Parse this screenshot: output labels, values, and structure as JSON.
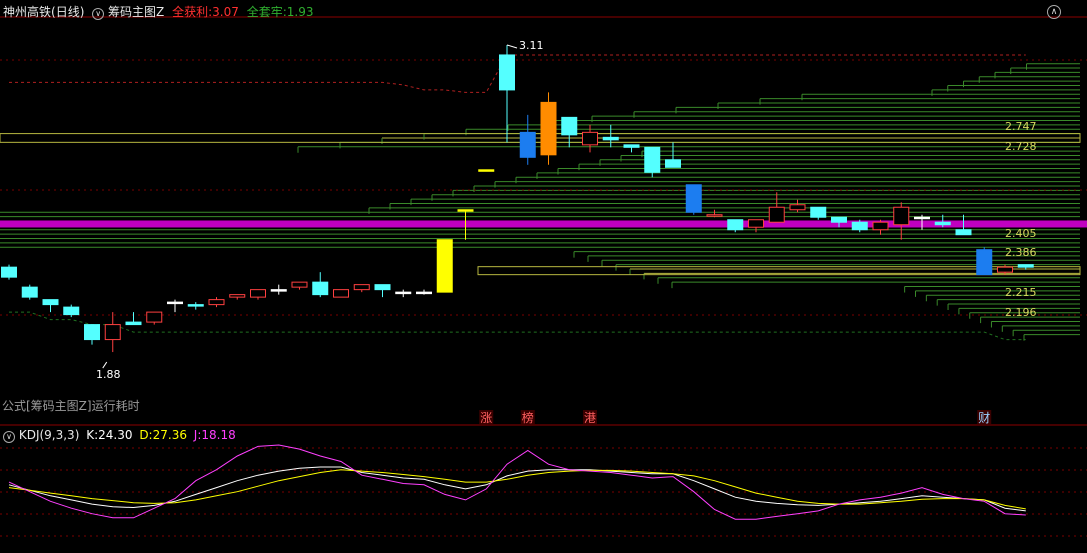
{
  "header": {
    "stock": "神州高铁",
    "period": "(日线)",
    "indicator": "筹码主图Z",
    "profit_label": "全获利:",
    "profit_value": "3.07",
    "trapped_label": "全套牢:",
    "trapped_value": "1.93"
  },
  "lower_header": {
    "name": "KDJ(9,3,3)",
    "k_label": "K:",
    "k_value": "24.30",
    "d_label": "D:",
    "d_value": "27.36",
    "j_label": "J:",
    "j_value": "18.18"
  },
  "notice": "公式[筹码主图Z]运行耗时",
  "colors": {
    "up": "#ff4040",
    "down": "#54ffff",
    "strong_down": "#1c7df0",
    "limit_up": "#ffff00",
    "orange": "#ff8c00",
    "cost_line": "#c000c0",
    "chip": "#3a8a2a",
    "chip_hl": "#b8b840",
    "profit_line": "#b02020",
    "trapped_line": "#207020",
    "k": "#ffffff",
    "d": "#ffff00",
    "j": "#ff40ff"
  },
  "chart_data": [
    {
      "type": "candlestick",
      "title": "神州高铁 (日线)",
      "ylim": [
        1.72,
        3.21
      ],
      "price_labels": [
        "2.747",
        "2.728",
        "2.405",
        "2.386",
        "2.215",
        "2.196"
      ],
      "high_mark": "3.11",
      "low_mark": "1.88",
      "main_cost": 2.395,
      "profit_line": [
        2.96,
        2.96,
        2.96,
        2.96,
        2.96,
        2.96,
        2.96,
        2.96,
        2.96,
        2.96,
        2.96,
        2.96,
        2.96,
        2.96,
        2.96,
        2.96,
        2.96,
        2.96,
        2.96,
        2.95,
        2.93,
        2.93,
        2.92,
        2.92,
        3.07,
        3.07,
        3.07,
        3.07,
        3.07,
        3.07,
        3.07,
        3.07,
        3.07,
        3.07,
        3.07,
        3.07,
        3.07,
        3.07,
        3.07,
        3.07,
        3.07,
        3.07,
        3.07,
        3.07,
        3.07,
        3.07,
        3.07,
        3.07,
        3.07,
        3.07
      ],
      "trapped_line": [
        2.04,
        2.04,
        2.01,
        2.01,
        1.99,
        1.99,
        1.96,
        1.96,
        1.96,
        1.96,
        1.96,
        1.96,
        1.96,
        1.96,
        1.96,
        1.96,
        1.96,
        1.96,
        1.96,
        1.96,
        1.96,
        1.96,
        1.96,
        1.96,
        1.96,
        1.96,
        1.96,
        1.96,
        1.96,
        1.96,
        1.96,
        1.96,
        1.96,
        1.96,
        1.96,
        1.96,
        1.96,
        1.96,
        1.96,
        1.96,
        1.96,
        1.96,
        1.96,
        1.96,
        1.96,
        1.96,
        1.96,
        1.96,
        1.93,
        1.93
      ],
      "candles": [
        {
          "o": 2.22,
          "h": 2.23,
          "l": 2.17,
          "c": 2.18,
          "color": "down"
        },
        {
          "o": 2.14,
          "h": 2.15,
          "l": 2.09,
          "c": 2.1,
          "color": "down"
        },
        {
          "o": 2.09,
          "h": 2.09,
          "l": 2.04,
          "c": 2.07,
          "color": "down"
        },
        {
          "o": 2.06,
          "h": 2.07,
          "l": 2.02,
          "c": 2.03,
          "color": "down"
        },
        {
          "o": 1.99,
          "h": 1.99,
          "l": 1.91,
          "c": 1.93,
          "color": "down"
        },
        {
          "o": 1.93,
          "h": 2.04,
          "l": 1.88,
          "c": 1.99,
          "color": "up"
        },
        {
          "o": 2.0,
          "h": 2.04,
          "l": 1.99,
          "c": 1.99,
          "color": "down"
        },
        {
          "o": 2.0,
          "h": 2.04,
          "l": 1.99,
          "c": 2.04,
          "color": "up"
        },
        {
          "o": 2.08,
          "h": 2.09,
          "l": 2.04,
          "c": 2.08,
          "color": "white"
        },
        {
          "o": 2.07,
          "h": 2.08,
          "l": 2.05,
          "c": 2.07,
          "color": "down"
        },
        {
          "o": 2.07,
          "h": 2.1,
          "l": 2.06,
          "c": 2.09,
          "color": "up"
        },
        {
          "o": 2.1,
          "h": 2.11,
          "l": 2.09,
          "c": 2.11,
          "color": "up"
        },
        {
          "o": 2.1,
          "h": 2.12,
          "l": 2.09,
          "c": 2.13,
          "color": "up"
        },
        {
          "o": 2.13,
          "h": 2.15,
          "l": 2.11,
          "c": 2.13,
          "color": "white"
        },
        {
          "o": 2.14,
          "h": 2.15,
          "l": 2.13,
          "c": 2.16,
          "color": "up"
        },
        {
          "o": 2.16,
          "h": 2.2,
          "l": 2.1,
          "c": 2.11,
          "color": "down"
        },
        {
          "o": 2.1,
          "h": 2.13,
          "l": 2.1,
          "c": 2.13,
          "color": "up"
        },
        {
          "o": 2.13,
          "h": 2.15,
          "l": 2.12,
          "c": 2.15,
          "color": "up"
        },
        {
          "o": 2.15,
          "h": 2.15,
          "l": 2.1,
          "c": 2.13,
          "color": "down"
        },
        {
          "o": 2.12,
          "h": 2.13,
          "l": 2.1,
          "c": 2.12,
          "color": "white"
        },
        {
          "o": 2.12,
          "h": 2.13,
          "l": 2.11,
          "c": 2.12,
          "color": "white"
        },
        {
          "o": 2.12,
          "h": 2.33,
          "l": 2.12,
          "c": 2.33,
          "color": "limit_up"
        },
        {
          "o": 2.45,
          "h": 2.45,
          "l": 2.33,
          "c": 2.45,
          "color": "limit_up"
        },
        {
          "o": 2.61,
          "h": 2.61,
          "l": 2.61,
          "c": 2.61,
          "color": "limit_up"
        },
        {
          "o": 3.07,
          "h": 3.11,
          "l": 2.72,
          "c": 2.93,
          "color": "down"
        },
        {
          "o": 2.76,
          "h": 2.83,
          "l": 2.63,
          "c": 2.66,
          "color": "strong_down"
        },
        {
          "o": 2.67,
          "h": 2.92,
          "l": 2.63,
          "c": 2.88,
          "color": "orange"
        },
        {
          "o": 2.82,
          "h": 2.82,
          "l": 2.7,
          "c": 2.75,
          "color": "down"
        },
        {
          "o": 2.71,
          "h": 2.79,
          "l": 2.68,
          "c": 2.76,
          "color": "up"
        },
        {
          "o": 2.74,
          "h": 2.79,
          "l": 2.7,
          "c": 2.73,
          "color": "down"
        },
        {
          "o": 2.71,
          "h": 2.71,
          "l": 2.68,
          "c": 2.7,
          "color": "down"
        },
        {
          "o": 2.7,
          "h": 2.7,
          "l": 2.58,
          "c": 2.6,
          "color": "down"
        },
        {
          "o": 2.65,
          "h": 2.72,
          "l": 2.64,
          "c": 2.62,
          "color": "down"
        },
        {
          "o": 2.55,
          "h": 2.55,
          "l": 2.43,
          "c": 2.44,
          "color": "strong_down"
        },
        {
          "o": 2.43,
          "h": 2.45,
          "l": 2.42,
          "c": 2.43,
          "color": "up"
        },
        {
          "o": 2.41,
          "h": 2.41,
          "l": 2.36,
          "c": 2.37,
          "color": "down"
        },
        {
          "o": 2.38,
          "h": 2.41,
          "l": 2.36,
          "c": 2.41,
          "color": "up"
        },
        {
          "o": 2.4,
          "h": 2.52,
          "l": 2.4,
          "c": 2.46,
          "color": "up"
        },
        {
          "o": 2.45,
          "h": 2.49,
          "l": 2.44,
          "c": 2.47,
          "color": "up"
        },
        {
          "o": 2.46,
          "h": 2.46,
          "l": 2.41,
          "c": 2.42,
          "color": "down"
        },
        {
          "o": 2.42,
          "h": 2.42,
          "l": 2.38,
          "c": 2.4,
          "color": "down"
        },
        {
          "o": 2.4,
          "h": 2.41,
          "l": 2.36,
          "c": 2.37,
          "color": "down"
        },
        {
          "o": 2.37,
          "h": 2.41,
          "l": 2.35,
          "c": 2.4,
          "color": "up"
        },
        {
          "o": 2.39,
          "h": 2.48,
          "l": 2.33,
          "c": 2.46,
          "color": "up"
        },
        {
          "o": 2.42,
          "h": 2.43,
          "l": 2.37,
          "c": 2.42,
          "color": "white"
        },
        {
          "o": 2.4,
          "h": 2.43,
          "l": 2.38,
          "c": 2.39,
          "color": "down"
        },
        {
          "o": 2.37,
          "h": 2.43,
          "l": 2.35,
          "c": 2.35,
          "color": "down"
        },
        {
          "o": 2.29,
          "h": 2.3,
          "l": 2.19,
          "c": 2.19,
          "color": "strong_down"
        },
        {
          "o": 2.2,
          "h": 2.23,
          "l": 2.19,
          "c": 2.22,
          "color": "up"
        },
        {
          "o": 2.23,
          "h": 2.23,
          "l": 2.21,
          "c": 2.22,
          "color": "down"
        }
      ],
      "annotations": [
        {
          "index": 23,
          "text": "涨"
        },
        {
          "index": 25,
          "text": "榜"
        },
        {
          "index": 28,
          "text": "港"
        },
        {
          "index": 47,
          "text": "财"
        }
      ]
    },
    {
      "type": "line",
      "title": "KDJ(9,3,3)",
      "ylim": [
        -30,
        120
      ],
      "series": [
        {
          "name": "K",
          "values": [
            62,
            54,
            46,
            40,
            34,
            30,
            29,
            32,
            38,
            48,
            58,
            68,
            76,
            82,
            86,
            88,
            88,
            80,
            76,
            72,
            70,
            62,
            56,
            62,
            75,
            82,
            84,
            84,
            84,
            82,
            80,
            78,
            78,
            68,
            56,
            44,
            38,
            35,
            33,
            32,
            34,
            36,
            38,
            42,
            46,
            44,
            42,
            40,
            28,
            24
          ]
        },
        {
          "name": "D",
          "values": [
            58,
            54,
            50,
            46,
            42,
            39,
            36,
            35,
            36,
            40,
            46,
            52,
            60,
            68,
            74,
            80,
            84,
            82,
            80,
            77,
            74,
            70,
            66,
            66,
            70,
            76,
            80,
            82,
            83,
            83,
            82,
            80,
            78,
            75,
            68,
            59,
            50,
            44,
            38,
            35,
            34,
            34,
            36,
            38,
            41,
            42,
            42,
            40,
            32,
            27
          ]
        },
        {
          "name": "J",
          "values": [
            66,
            52,
            38,
            28,
            20,
            14,
            14,
            28,
            42,
            68,
            84,
            104,
            118,
            120,
            114,
            104,
            96,
            76,
            70,
            64,
            62,
            48,
            40,
            56,
            92,
            112,
            92,
            84,
            82,
            80,
            76,
            72,
            74,
            52,
            26,
            12,
            12,
            16,
            20,
            24,
            34,
            40,
            44,
            50,
            58,
            48,
            42,
            38,
            20,
            18
          ]
        }
      ]
    }
  ]
}
